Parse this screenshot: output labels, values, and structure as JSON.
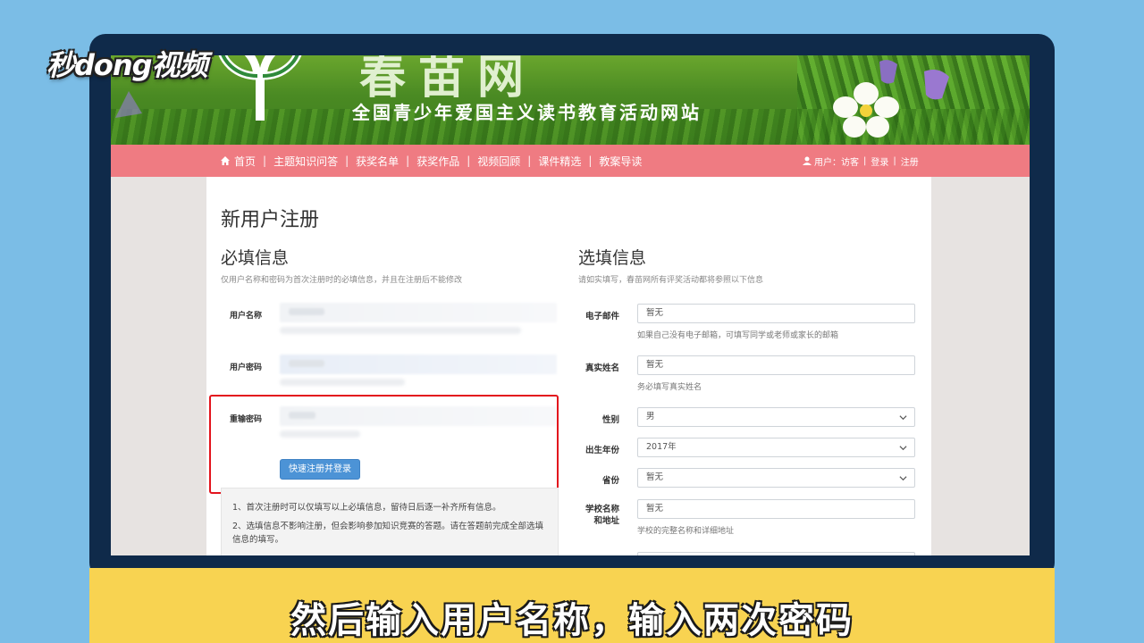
{
  "overlay": {
    "brand_logo": "秒dong视频",
    "caption": "然后输入用户名称，输入两次密码"
  },
  "banner": {
    "site_name": "春苗网",
    "tagline": "全国青少年爱国主义读书教育活动网站"
  },
  "nav": {
    "items": [
      "首页",
      "主题知识问答",
      "获奖名单",
      "获奖作品",
      "视频回顾",
      "课件精选",
      "教案导读"
    ],
    "user_label": "用户：",
    "user_name": "访客",
    "login": "登录",
    "register": "注册"
  },
  "page": {
    "title": "新用户注册"
  },
  "required": {
    "title": "必填信息",
    "description": "仅用户名称和密码为首次注册时的必填信息，并且在注册后不能修改",
    "username_label": "用户名称",
    "password_label": "用户密码",
    "confirm_label": "重输密码",
    "submit": "快速注册并登录"
  },
  "notes": {
    "line1": "1、首次注册时可以仅填写以上必填信息，留待日后逐一补齐所有信息。",
    "line2": "2、选填信息不影响注册，但会影响参加知识竞赛的答题。请在答题前完成全部选填信息的填写。"
  },
  "optional": {
    "title": "选填信息",
    "description": "请如实填写，春苗网所有评奖活动都将参照以下信息",
    "email_label": "电子邮件",
    "email_value": "暂无",
    "email_help": "如果自己没有电子邮箱，可填写同学或老师或家长的邮箱",
    "realname_label": "真实姓名",
    "realname_value": "暂无",
    "realname_help": "务必填写真实姓名",
    "gender_label": "性别",
    "gender_value": "男",
    "birth_label": "出生年份",
    "birth_value": "2017年",
    "province_label": "省份",
    "province_value": "暂无",
    "school_label_1": "学校名称",
    "school_label_2": "和地址",
    "school_value": "暂无",
    "school_help": "学校的完整名称和详细地址"
  },
  "colors": {
    "nav_bg": "#ef7b82",
    "highlight": "#e3141d",
    "button": "#4c93d6",
    "caption_bar": "#f8d351"
  }
}
